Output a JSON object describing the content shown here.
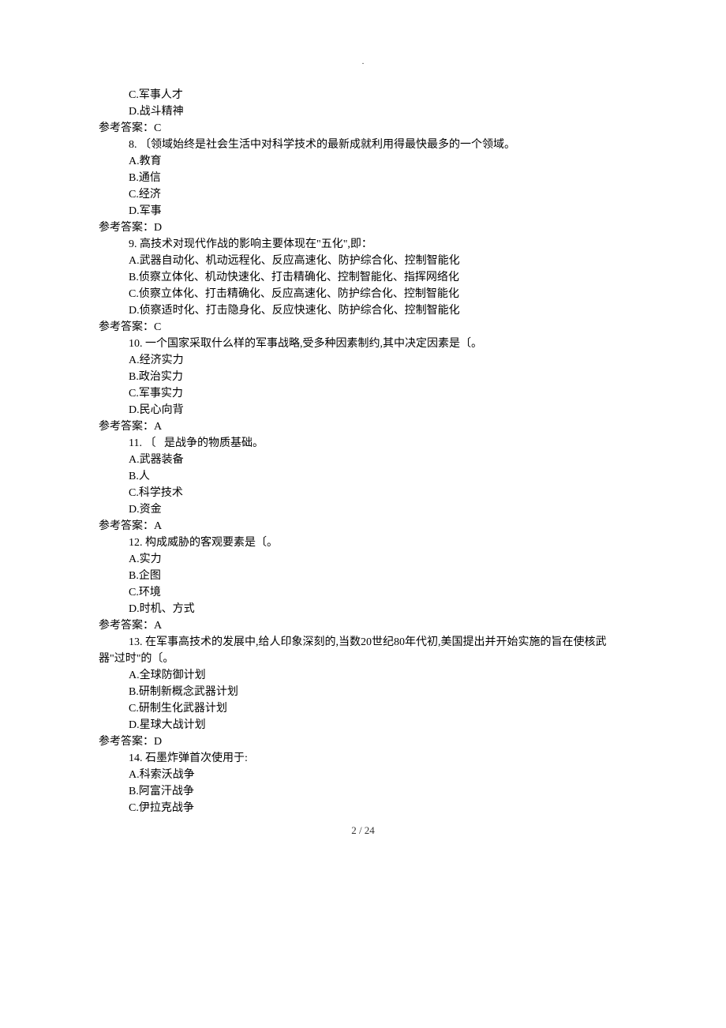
{
  "header_dot": ".",
  "page_number": "2 / 24",
  "prev_q7": {
    "C": "C.军事人才",
    "D": "D.战斗精神",
    "answer": "参考答案：C"
  },
  "q8": {
    "text": "8. 〔领域始终是社会生活中对科学技术的最新成就利用得最快最多的一个领域。",
    "A": "A.教育",
    "B": "B.通信",
    "C": "C.经济",
    "D": "D.军事",
    "answer": "参考答案：D"
  },
  "q9": {
    "text": "9. 高技术对现代作战的影响主要体现在\"五化\",即：",
    "A": "A.武器自动化、机动远程化、反应高速化、防护综合化、控制智能化",
    "B": "B.侦察立体化、机动快速化、打击精确化、控制智能化、指挥网络化",
    "C": "C.侦察立体化、打击精确化、反应高速化、防护综合化、控制智能化",
    "D": "D.侦察适时化、打击隐身化、反应快速化、防护综合化、控制智能化",
    "answer": "参考答案：C"
  },
  "q10": {
    "text": "10. 一个国家采取什么样的军事战略,受多种因素制约,其中决定因素是〔。",
    "A": "A.经济实力",
    "B": "B.政治实力",
    "C": "C.军事实力",
    "D": "D.民心向背",
    "answer": "参考答案：A"
  },
  "q11": {
    "text": "11. 〔   是战争的物质基础。",
    "A": "A.武器装备",
    "B": "B.人",
    "C": "C.科学技术",
    "D": "D.资金",
    "answer": "参考答案：A"
  },
  "q12": {
    "text": "12. 构成威胁的客观要素是〔。",
    "A": "A.实力",
    "B": "B.企图",
    "C": "C.环境",
    "D": "D.时机、方式",
    "answer": "参考答案：A"
  },
  "q13": {
    "text1": "13. 在军事高技术的发展中,给人印象深刻的,当数20世纪80年代初,美国提出并开始实施的旨在使核武",
    "text2": "器\"过时\"的〔。",
    "A": "A.全球防御计划",
    "B": "B.研制新概念武器计划",
    "C": "C.研制生化武器计划",
    "D": "D.星球大战计划",
    "answer": "参考答案：D"
  },
  "q14": {
    "text": "14. 石墨炸弹首次使用于:",
    "A": "A.科索沃战争",
    "B": "B.阿富汗战争",
    "C": "C.伊拉克战争"
  }
}
